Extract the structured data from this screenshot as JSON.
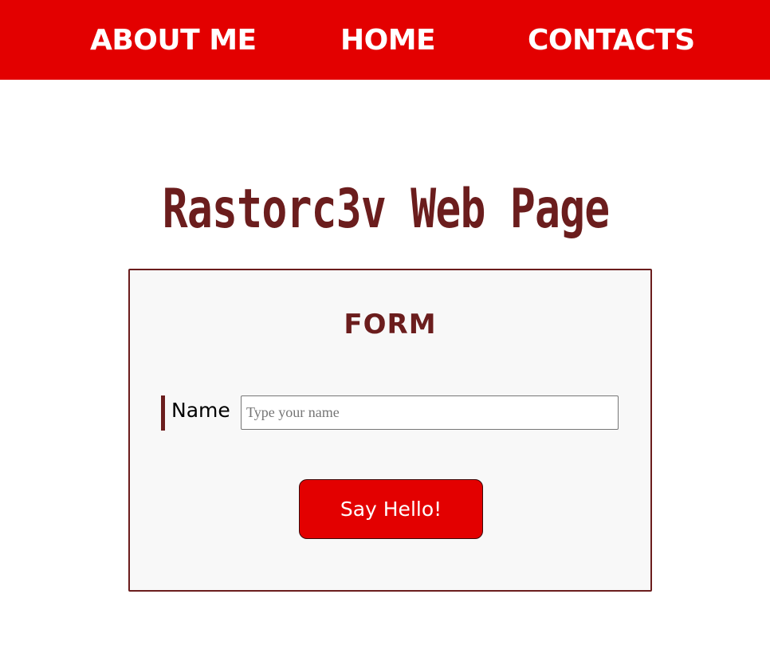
{
  "nav": {
    "items": [
      {
        "label": "ABOUT ME"
      },
      {
        "label": "HOME"
      },
      {
        "label": "CONTACTS"
      }
    ]
  },
  "page": {
    "title": "Rastorc3v Web Page"
  },
  "form": {
    "heading": "FORM",
    "name_label": "Name",
    "name_placeholder": "Type your name",
    "name_value": "",
    "submit_label": "Say Hello!"
  },
  "colors": {
    "nav_background": "#e30000",
    "accent_dark_red": "#6b1d1d",
    "button_background": "#e30000",
    "form_background": "#f8f8f8"
  }
}
